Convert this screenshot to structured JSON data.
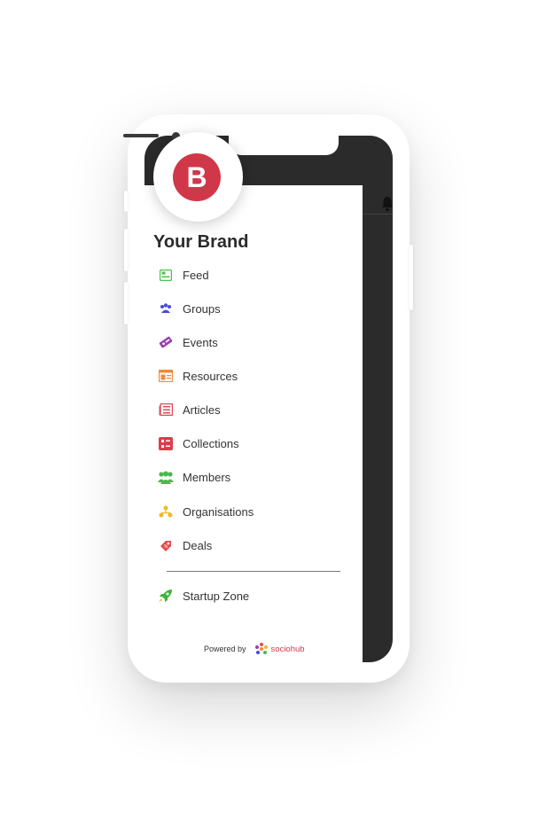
{
  "brand": {
    "initial": "B",
    "name": "Your Brand"
  },
  "menu": {
    "items": [
      {
        "label": "Feed",
        "icon": "feed-icon",
        "color": "#4cc24c"
      },
      {
        "label": "Groups",
        "icon": "groups-icon",
        "color": "#4b4bd8"
      },
      {
        "label": "Events",
        "icon": "events-icon",
        "color": "#9b3fb0"
      },
      {
        "label": "Resources",
        "icon": "resources-icon",
        "color": "#f08a3a"
      },
      {
        "label": "Articles",
        "icon": "articles-icon",
        "color": "#e24a5a"
      },
      {
        "label": "Collections",
        "icon": "collections-icon",
        "color": "#e23a4a"
      },
      {
        "label": "Members",
        "icon": "members-icon",
        "color": "#4cb84c"
      },
      {
        "label": "Organisations",
        "icon": "organisations-icon",
        "color": "#f0b820"
      },
      {
        "label": "Deals",
        "icon": "deals-icon",
        "color": "#e24a4a"
      }
    ],
    "startup": {
      "label": "Startup Zone",
      "icon": "rocket-icon",
      "color": "#3cb43c"
    }
  },
  "footer": {
    "powered_by": "Powered by",
    "logo_text": "sociohub"
  },
  "colors": {
    "accent": "#d0384a",
    "screen": "#2b2b2b"
  }
}
